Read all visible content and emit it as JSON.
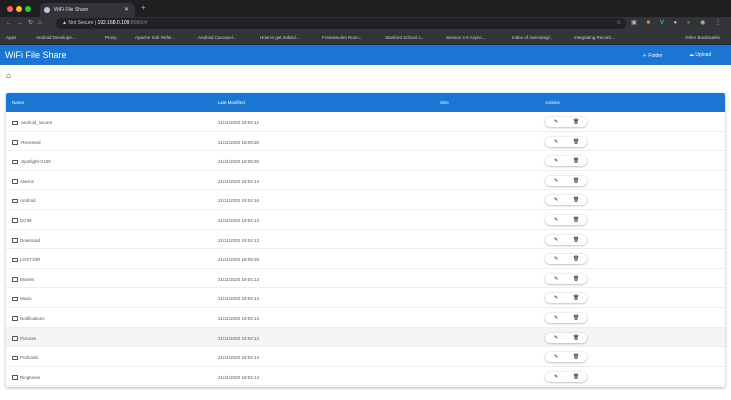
{
  "browser": {
    "tab_title": "WiFi File Share",
    "security": "Not Secure",
    "url_host": "192.168.0.109",
    "url_rest": ":8080/#/",
    "bookmarks": [
      "Apps",
      "Android Develope...",
      "Proxy",
      "Apache Solr Refer...",
      "Android Carousel...",
      "How to get Individ...",
      "Frameworks Roun...",
      "Stanford School o...",
      "Service 3.0 Async...",
      "Index of /avimanig/...",
      "Integrating Recurit...",
      "Other Bookmarks"
    ]
  },
  "app": {
    "title": "WiFi File Share",
    "folder_label": "Folder",
    "upload_label": "Upload"
  },
  "table": {
    "headers": {
      "name": "Name",
      "modified": "Last Modified",
      "size": "Size",
      "actions": "Actions"
    },
    "rows": [
      {
        "name": ".android_secure",
        "modified": "21/11/2020 19:04:12"
      },
      {
        "name": ".Recented",
        "modified": "21/11/2020 18:09:30"
      },
      {
        "name": ".Spotlight-V100",
        "modified": "21/11/2020 18:09:30"
      },
      {
        "name": "Alarms",
        "modified": "21/11/2020 19:04:13"
      },
      {
        "name": "Android",
        "modified": "21/11/2020 19:04:16"
      },
      {
        "name": "DCIM",
        "modified": "21/11/2020 19:04:13"
      },
      {
        "name": "Download",
        "modified": "21/11/2020 19:04:13"
      },
      {
        "name": "LOST.DIR",
        "modified": "21/11/2020 18:08:38"
      },
      {
        "name": "Movies",
        "modified": "21/11/2020 19:04:13"
      },
      {
        "name": "Music",
        "modified": "21/11/2020 19:04:13"
      },
      {
        "name": "Notifications",
        "modified": "21/11/2020 19:04:13"
      },
      {
        "name": "Pictures",
        "modified": "21/11/2020 19:04:13"
      },
      {
        "name": "Podcasts",
        "modified": "21/11/2020 19:04:13"
      },
      {
        "name": "Ringtones",
        "modified": "21/11/2020 19:04:13"
      }
    ]
  }
}
